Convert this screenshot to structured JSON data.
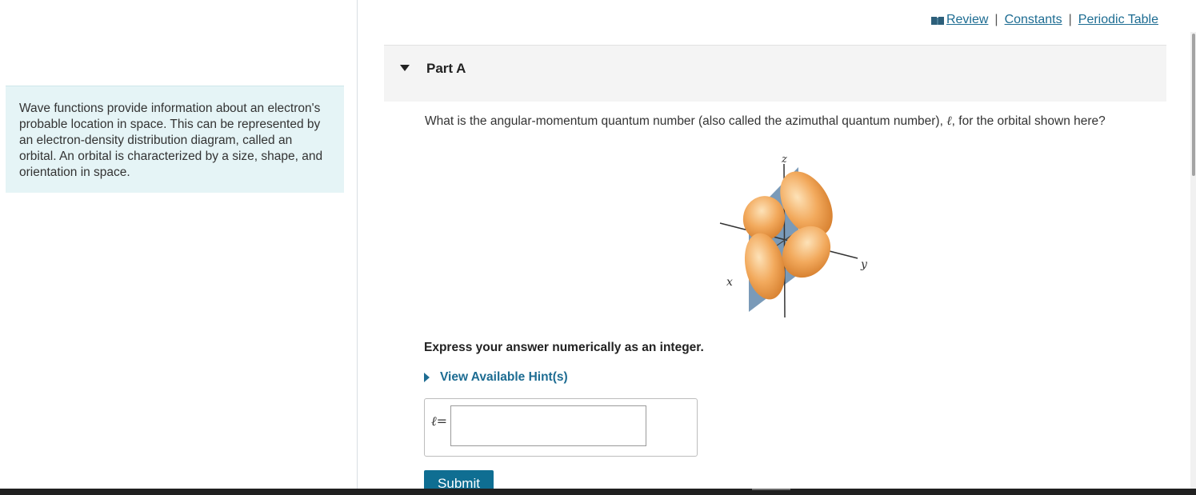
{
  "sidebar": {
    "intro_text": "Wave functions provide information about an electron's probable location in space. This can be represented by an electron-density distribution diagram, called an orbital.  An orbital is characterized by a size, shape, and orientation in space."
  },
  "header": {
    "links": {
      "review": "Review",
      "constants": "Constants",
      "periodic_table": "Periodic Table"
    },
    "separator": "|"
  },
  "part": {
    "title": "Part A",
    "question_before": "What is the angular-momentum quantum number (also called the azimuthal quantum number), ",
    "question_symbol": "ℓ",
    "question_after": ", for the orbital shown here?",
    "figure_labels": {
      "z": "z",
      "x": "x",
      "y": "y"
    },
    "instruction": "Express your answer numerically as an integer.",
    "hint_link": "View Available Hint(s)",
    "answer_label": "ℓ=",
    "answer_value": "",
    "submit_label": "Submit"
  },
  "colors": {
    "link": "#1d6c92",
    "submit_bg": "#0f6e92",
    "intro_bg": "#e5f4f6",
    "orbital": "#f0a45a",
    "plane": "#6b8fb0"
  }
}
